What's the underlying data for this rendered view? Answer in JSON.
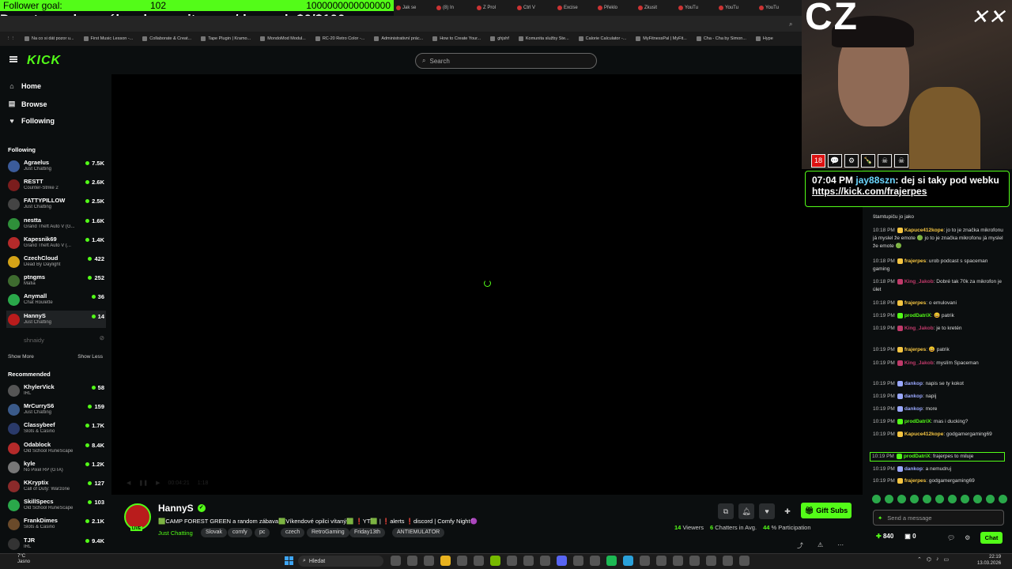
{
  "overlay": {
    "goal_label": "Follower goal:",
    "goal_current": "102",
    "goal_target": "1000000000000000",
    "donate_text": "Donate goal na nákup komunita.com/deynyel: $0/$100"
  },
  "browser": {
    "tabs": [
      "Jak se",
      "(8) In",
      "Z Prol",
      "Ctrl V",
      "Excise",
      "Překlo",
      "Zkusit",
      "YouTu",
      "YouTu",
      "YouTu"
    ],
    "bookmarks": [
      "Na co si dát pozor u...",
      "First Music Lesson -...",
      "Collaborate & Creat...",
      "Tape Plugin | Kramo...",
      "MondoMod Modul...",
      "RC-20 Retro Color -...",
      "Administrativní prác...",
      "How to Create Your...",
      "ghjshf",
      "Komunita služby Ste...",
      "Calorie Calculator -...",
      "MyFitnessPal | MyFit...",
      "Cha - Cha by Simon...",
      "Hype"
    ]
  },
  "header": {
    "logo": "KICK",
    "search_placeholder": "Search"
  },
  "sidebar": {
    "nav": [
      {
        "label": "Home",
        "icon": "home-icon"
      },
      {
        "label": "Browse",
        "icon": "browse-icon"
      },
      {
        "label": "Following",
        "icon": "heart-icon"
      }
    ],
    "following_title": "Following",
    "following": [
      {
        "name": "Agraelus",
        "game": "Just Chatting",
        "viewers": "7.5K",
        "color": "#3b5b9a"
      },
      {
        "name": "RESTT",
        "game": "Counter-Strike 2",
        "viewers": "2.6K",
        "color": "#7a1d1d"
      },
      {
        "name": "FATTYPILLOW",
        "game": "Just Chatting",
        "viewers": "2.5K",
        "color": "#444"
      },
      {
        "name": "nestta",
        "game": "Grand Theft Auto V (G...",
        "viewers": "1.6K",
        "color": "#2f8f3a"
      },
      {
        "name": "Kapesnik69",
        "game": "Grand Theft Auto V (...",
        "viewers": "1.4K",
        "color": "#b42a2a"
      },
      {
        "name": "CzechCloud",
        "game": "Dead By Daylight",
        "viewers": "422",
        "color": "#d4a317"
      },
      {
        "name": "ptngms",
        "game": "Mafia",
        "viewers": "252",
        "color": "#3e6b2f"
      },
      {
        "name": "Anymall",
        "game": "Chat Roulette",
        "viewers": "36",
        "color": "#2aa84a"
      },
      {
        "name": "HannyS",
        "game": "Just Chatting",
        "viewers": "14",
        "color": "#b91c1c"
      }
    ],
    "offline_channel": "shnaidy",
    "show_more": "Show More",
    "show_less": "Show Less",
    "recommended_title": "Recommended",
    "recommended": [
      {
        "name": "KhylerVick",
        "game": "IRL",
        "viewers": "58",
        "color": "#555"
      },
      {
        "name": "MrCurryS6",
        "game": "Just Chatting",
        "viewers": "159",
        "color": "#3a5a8a"
      },
      {
        "name": "Classybeef",
        "game": "Slots & Casino",
        "viewers": "1.7K",
        "color": "#2a3a6a"
      },
      {
        "name": "Odablock",
        "game": "Old School RuneScape",
        "viewers": "8.4K",
        "color": "#b42a2a"
      },
      {
        "name": "kyle",
        "game": "No Pixel RP (GTA)",
        "viewers": "1.2K",
        "color": "#777"
      },
      {
        "name": "KKryptix",
        "game": "Call of Duty: Warzone",
        "viewers": "127",
        "color": "#8a2a2a"
      },
      {
        "name": "SkillSpecs",
        "game": "Old School RuneScape",
        "viewers": "103",
        "color": "#2aa84a"
      },
      {
        "name": "FrankDimes",
        "game": "Slots & Casino",
        "viewers": "2.1K",
        "color": "#6a4a2a"
      },
      {
        "name": "TJR",
        "game": "IRL",
        "viewers": "9.4K",
        "color": "#333"
      }
    ]
  },
  "player": {
    "time_display": "00:04:21",
    "duration": "1:18"
  },
  "channel": {
    "name": "HannyS",
    "live_badge": "LIVE",
    "title": "🟩CAMP FOREST GREEN a random zábava🟩Víkendové opilci vítaný🟩 ❗YT🟩 | ❗alerts ❗discord | Comfy Night🟣",
    "category": "Just Chatting",
    "tags": [
      "Slovak",
      "comfy",
      "pc",
      "czech",
      "RetroGaming",
      "Friday13th",
      "ANTIEMULATOR"
    ],
    "gift_subs": "Gift Subs",
    "viewers": "14",
    "viewers_label": "Viewers",
    "chatters": "6",
    "chatters_label": "Chatters in Avg.",
    "participation": "44",
    "participation_label": "% Participation"
  },
  "webcam": {
    "big_text": "CZ",
    "badges": [
      "18",
      "💬",
      "⚙",
      "🍾",
      "☠",
      "☠"
    ]
  },
  "pinned": {
    "time": "07:04 PM",
    "user": "jay88szn",
    "text": ": dej si taky pod webku ",
    "link": "https://kick.com/frajerpes"
  },
  "chat": {
    "messages": [
      {
        "time": "",
        "user": "",
        "color": "#ccc",
        "text": "štamtupiču jo jako"
      },
      {
        "time": "10:18 PM",
        "user": "Kapuce412kope",
        "color": "#f5c542",
        "text": ": jo to je značka mikrofonu já myslel že emote 🟢 jo to je značka mikrofonu já myslel že emote 🟢"
      },
      {
        "time": "10:18 PM",
        "user": "frajerpes",
        "color": "#f5c542",
        "text": ": urob podcast s spaceman gaming"
      },
      {
        "time": "10:18 PM",
        "user": "King_Jakob",
        "color": "#c03a6a",
        "text": ": Dobré tak 70k za mikrofon je úlet"
      },
      {
        "time": "10:18 PM",
        "user": "frajerpes",
        "color": "#f5c542",
        "text": ": o emulovani"
      },
      {
        "time": "10:19 PM",
        "user": "prodDatriX",
        "color": "#53fc18",
        "text": ": 😀 patrik"
      },
      {
        "time": "10:19 PM",
        "user": "King_Jakob",
        "color": "#c03a6a",
        "text": ": je to kretén"
      },
      {
        "time": "10:19 PM",
        "user": "frajerpes",
        "color": "#f5c542",
        "text": ": 😀 patrik"
      },
      {
        "time": "10:19 PM",
        "user": "King_Jakob",
        "color": "#c03a6a",
        "text": ": myslím Spaceman"
      },
      {
        "time": "10:19 PM",
        "user": "dankop",
        "color": "#9aa8ff",
        "text": ": napis se ty kokot"
      },
      {
        "time": "10:19 PM",
        "user": "dankop",
        "color": "#9aa8ff",
        "text": ": napij"
      },
      {
        "time": "10:19 PM",
        "user": "dankop",
        "color": "#9aa8ff",
        "text": ": more"
      },
      {
        "time": "10:19 PM",
        "user": "prodDatriX",
        "color": "#53fc18",
        "text": ": mas i ducking?"
      },
      {
        "time": "10:19 PM",
        "user": "Kapuce412kope",
        "color": "#f5c542",
        "text": ": godgamergaming69"
      },
      {
        "time": "10:19 PM",
        "user": "prodDatriX",
        "color": "#53fc18",
        "text": ": frajerpes to miluje"
      },
      {
        "time": "10:19 PM",
        "user": "dankop",
        "color": "#9aa8ff",
        "text": ": a nemudruj"
      },
      {
        "time": "10:19 PM",
        "user": "frajerpes",
        "color": "#f5c542",
        "text": ": godgamergaming69"
      }
    ],
    "input_placeholder": "Send a message",
    "points": "840",
    "count": "0",
    "chat_button": "Chat"
  },
  "taskbar": {
    "temperature": "7°C",
    "weather": "Jasno",
    "search": "Hledat",
    "time": "22:19",
    "date": "13.03.2026"
  }
}
